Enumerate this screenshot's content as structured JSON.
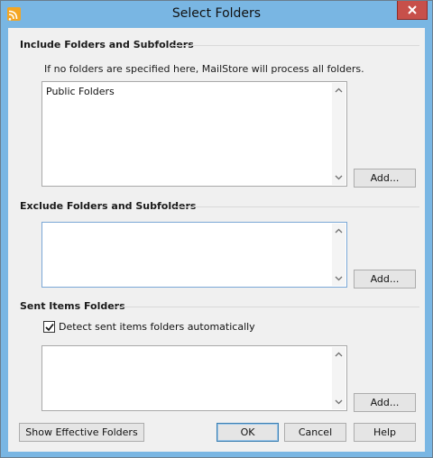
{
  "window": {
    "title": "Select Folders",
    "icon": "mailstore-app-icon"
  },
  "include": {
    "title": "Include Folders and Subfolders",
    "hint": "If no folders are specified here, MailStore will process all folders.",
    "items": [
      "Public Folders"
    ],
    "add_label": "Add..."
  },
  "exclude": {
    "title": "Exclude Folders and Subfolders",
    "items": [],
    "add_label": "Add..."
  },
  "sent": {
    "title": "Sent Items Folders",
    "detect_label": "Detect sent items folders automatically",
    "detect_checked": true,
    "items": [],
    "add_label": "Add..."
  },
  "footer": {
    "show_effective_label": "Show Effective Folders",
    "ok_label": "OK",
    "cancel_label": "Cancel",
    "help_label": "Help"
  },
  "colors": {
    "titlebar": "#79b6e3",
    "close": "#c7504a",
    "dialog_bg": "#f0f0f0"
  }
}
